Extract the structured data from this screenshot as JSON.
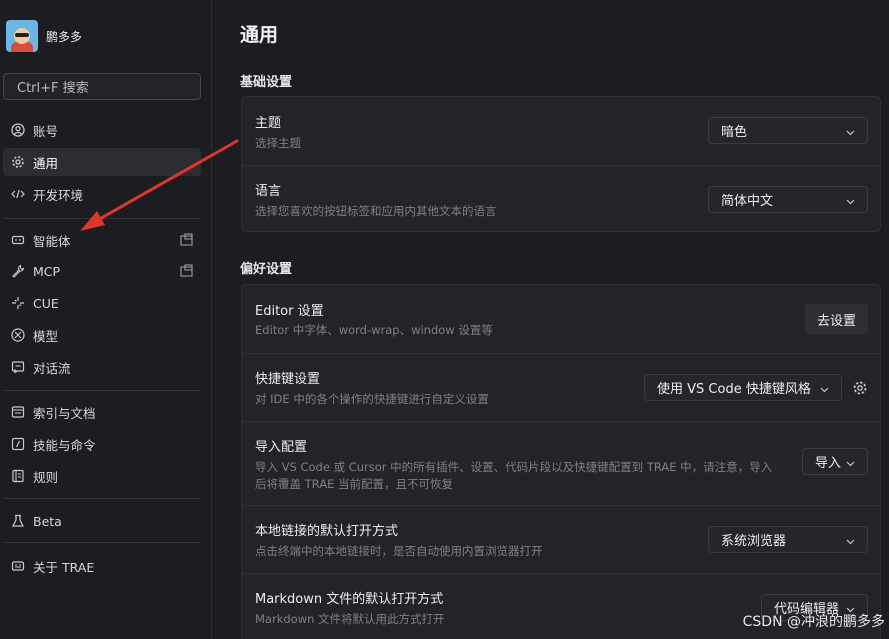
{
  "profile": {
    "name": "鹏多多"
  },
  "search": {
    "label": "Ctrl+F 搜索"
  },
  "sidebar": {
    "items": [
      {
        "label": "账号",
        "icon": "user-circle-icon"
      },
      {
        "label": "通用",
        "icon": "gear-icon",
        "active": true
      },
      {
        "label": "开发环境",
        "icon": "code-icon"
      },
      {
        "label": "智能体",
        "icon": "agent-icon",
        "external": true
      },
      {
        "label": "MCP",
        "icon": "wrench-icon",
        "external": true
      },
      {
        "label": "CUE",
        "icon": "cue-icon"
      },
      {
        "label": "模型",
        "icon": "model-icon"
      },
      {
        "label": "对话流",
        "icon": "chat-flow-icon"
      },
      {
        "label": "索引与文档",
        "icon": "index-doc-icon"
      },
      {
        "label": "技能与命令",
        "icon": "skill-command-icon"
      },
      {
        "label": "规则",
        "icon": "rules-icon"
      },
      {
        "label": "Beta",
        "icon": "beta-flask-icon"
      },
      {
        "label": "关于 TRAE",
        "icon": "about-icon"
      }
    ]
  },
  "main": {
    "title": "通用",
    "basic": {
      "heading": "基础设置",
      "theme": {
        "title": "主题",
        "desc": "选择主题",
        "value": "暗色"
      },
      "language": {
        "title": "语言",
        "desc": "选择您喜欢的按钮标签和应用内其他文本的语言",
        "value": "简体中文"
      }
    },
    "prefs": {
      "heading": "偏好设置",
      "editor": {
        "title": "Editor 设置",
        "desc": "Editor 中字体、word-wrap、window 设置等",
        "button": "去设置"
      },
      "shortcuts": {
        "title": "快捷键设置",
        "desc": "对 IDE 中的各个操作的快捷键进行自定义设置",
        "value": "使用 VS Code 快捷键风格"
      },
      "import": {
        "title": "导入配置",
        "desc_line1": "导入 VS Code 或 Cursor 中的所有插件、设置、代码片段以及快捷键配置到 TRAE 中，请注意，导入",
        "desc_line2": "后将覆盖 TRAE 当前配置，且不可恢复",
        "button": "导入"
      },
      "local_link": {
        "title": "本地链接的默认打开方式",
        "desc": "点击终端中的本地链接时，是否自动使用内置浏览器打开",
        "value": "系统浏览器"
      },
      "markdown": {
        "title": "Markdown 文件的默认打开方式",
        "desc": "Markdown 文件将默认用此方式打开",
        "value": "代码编辑器"
      }
    }
  },
  "watermark": "CSDN @冲浪的鹏多多",
  "colors": {
    "background": "#1c1d21",
    "card": "#232429",
    "arrow": "#e0352b"
  }
}
